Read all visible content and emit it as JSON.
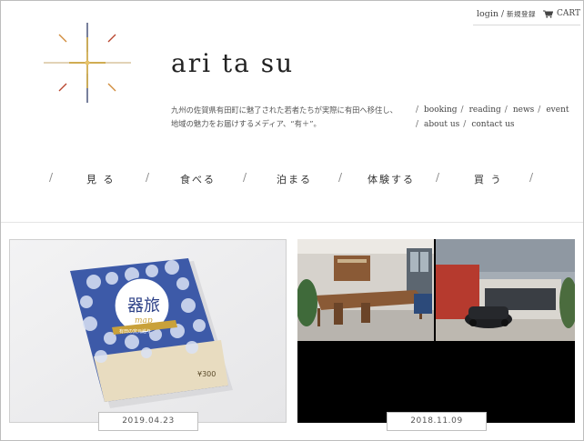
{
  "header": {
    "login_label": "login",
    "separator": "/",
    "register_label": "新規登録",
    "cart_label": "CART"
  },
  "logo": {
    "text": "ari ta su",
    "mark_icon": "star-sparkle-icon"
  },
  "description": {
    "line1": "九州の佐賀県有田町に魅了された若者たちが実際に有田へ移住し、",
    "line2": "地域の魅力をお届けするメディア、“有＋”。"
  },
  "subnav": {
    "row1": [
      "booking",
      "reading",
      "news",
      "event"
    ],
    "row2": [
      "about us",
      "contact us"
    ]
  },
  "mainnav": {
    "items": [
      "見 る",
      "食べる",
      "泊まる",
      "体験する",
      "買 う"
    ]
  },
  "posts": [
    {
      "date": "2019.04.23",
      "book_title_line1": "器",
      "book_title_line2": "旅",
      "book_subtitle": "map",
      "book_band": "有田の窯元巡り",
      "book_price": "¥300",
      "colors": {
        "book_blue": "#3d5aa8",
        "book_cream": "#e8dcc0"
      }
    },
    {
      "date": "2018.11.09",
      "colors": {
        "interior_wood": "#8a5a36",
        "sky": "#9aa3ab",
        "red_building": "#b63a2e"
      }
    }
  ],
  "colors": {
    "logo_gold": "#c9a13a",
    "logo_navy": "#1d2a5a",
    "text": "#333333",
    "divider": "#e5e5e5"
  }
}
